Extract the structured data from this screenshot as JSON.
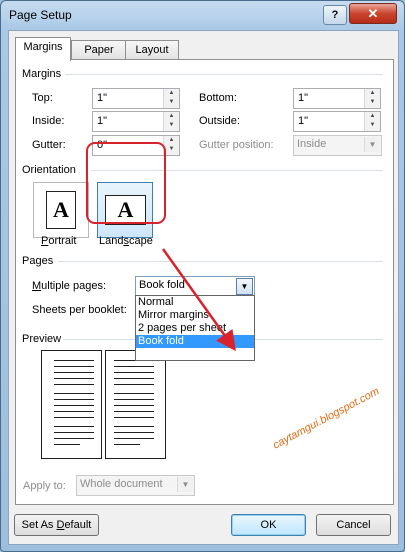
{
  "window": {
    "title": "Page Setup",
    "help_label": "?",
    "close_label": "✕"
  },
  "tabs": [
    {
      "label": "Margins",
      "active": true
    },
    {
      "label": "Paper",
      "active": false
    },
    {
      "label": "Layout",
      "active": false
    }
  ],
  "margins": {
    "heading": "Margins",
    "top_label": "Top:",
    "top_value": "1\"",
    "bottom_label": "Bottom:",
    "bottom_value": "1\"",
    "inside_label": "Inside:",
    "inside_value": "1\"",
    "outside_label": "Outside:",
    "outside_value": "1\"",
    "gutter_label": "Gutter:",
    "gutter_value": "0\"",
    "gutter_position_label": "Gutter position:",
    "gutter_position_value": "Inside"
  },
  "orientation": {
    "heading": "Orientation",
    "portrait_label": "Portrait",
    "landscape_label": "Landscape",
    "glyph": "A",
    "selected": "Landscape"
  },
  "pages": {
    "heading": "Pages",
    "multiple_pages_label": "Multiple pages:",
    "multiple_pages_value": "Book fold",
    "sheets_per_booklet_label": "Sheets per booklet:",
    "options": [
      "Normal",
      "Mirror margins",
      "2 pages per sheet",
      "Book fold"
    ],
    "highlighted_option": "Book fold"
  },
  "preview": {
    "heading": "Preview"
  },
  "apply_to": {
    "label": "Apply to:",
    "value": "Whole document"
  },
  "buttons": {
    "set_default": "Set As Default",
    "ok": "OK",
    "cancel": "Cancel"
  },
  "watermark": "caytamgui.blogspot.com",
  "colors": {
    "highlight": "#3399ff",
    "annotation_red": "#d8222c",
    "watermark": "#e06b16"
  }
}
